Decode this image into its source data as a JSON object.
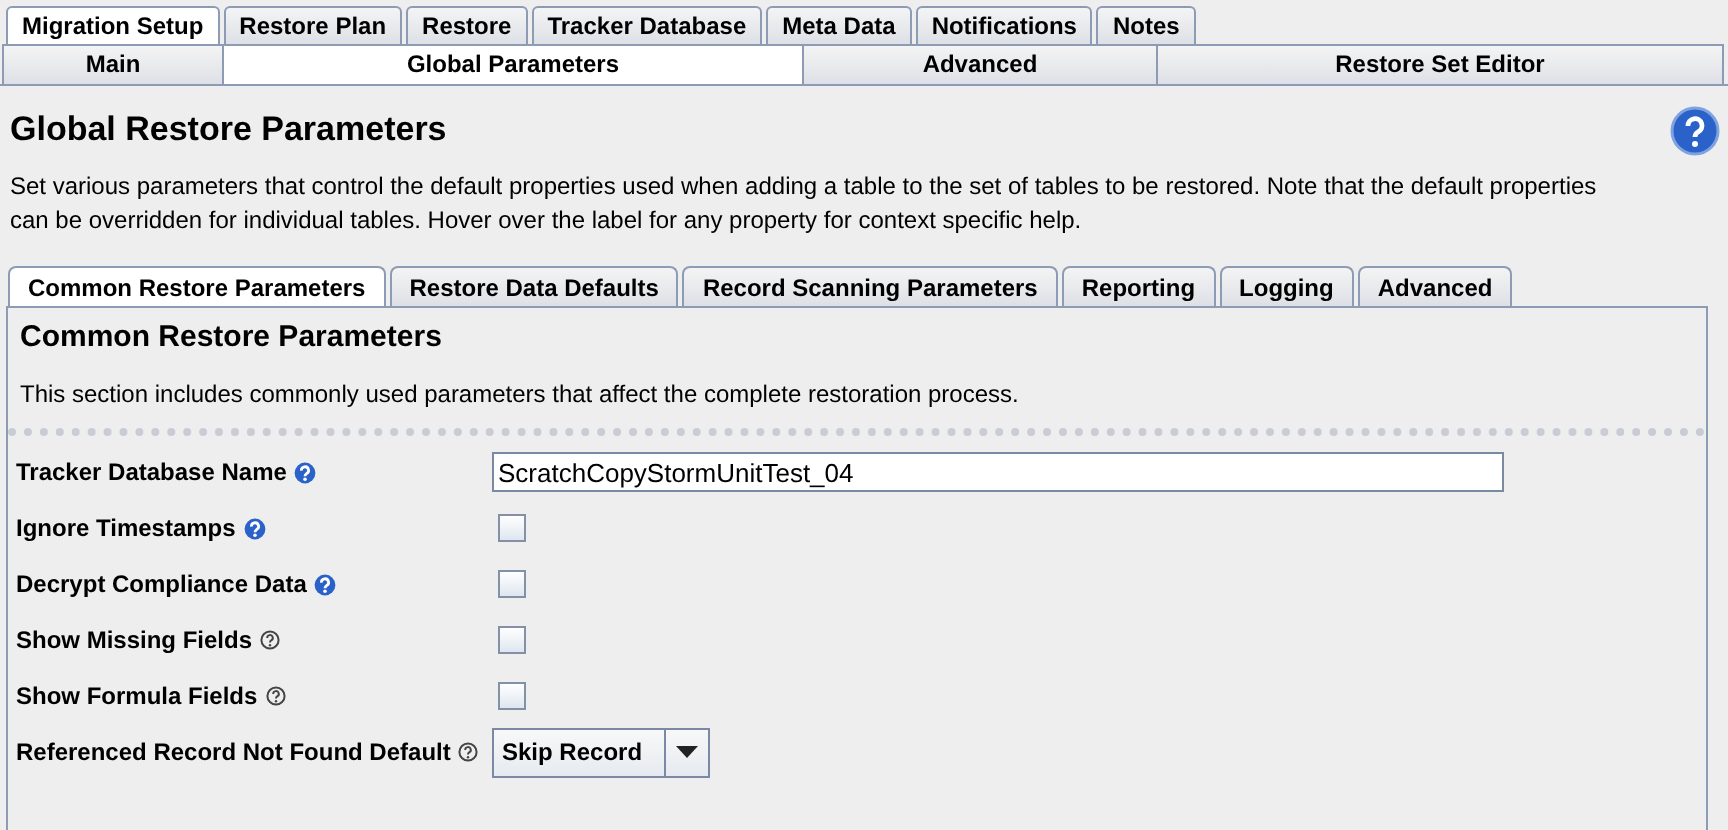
{
  "top_tabs": [
    {
      "label": "Migration Setup",
      "selected": true
    },
    {
      "label": "Restore Plan",
      "selected": false
    },
    {
      "label": "Restore",
      "selected": false
    },
    {
      "label": "Tracker Database",
      "selected": false
    },
    {
      "label": "Meta Data",
      "selected": false
    },
    {
      "label": "Notifications",
      "selected": false
    },
    {
      "label": "Notes",
      "selected": false
    }
  ],
  "sub_tabs": [
    {
      "label": "Main",
      "selected": false
    },
    {
      "label": "Global Parameters",
      "selected": true
    },
    {
      "label": "Advanced",
      "selected": false
    },
    {
      "label": "Restore Set Editor",
      "selected": false
    }
  ],
  "title": "Global Restore Parameters",
  "description": "Set various parameters that control the default properties used when adding a table to the set of tables to be restored. Note that the default properties can be overridden for individual tables. Hover over the label for any property for context specific help.",
  "section_tabs": [
    {
      "label": "Common Restore Parameters",
      "selected": true
    },
    {
      "label": "Restore Data Defaults",
      "selected": false
    },
    {
      "label": "Record Scanning Parameters",
      "selected": false
    },
    {
      "label": "Reporting",
      "selected": false
    },
    {
      "label": "Logging",
      "selected": false
    },
    {
      "label": "Advanced",
      "selected": false
    }
  ],
  "section": {
    "title": "Common Restore Parameters",
    "description": "This section includes commonly used parameters that affect the complete restoration process."
  },
  "properties": [
    {
      "label": "Tracker Database Name",
      "help_highlighted": true,
      "kind": "text",
      "value": "ScratchCopyStormUnitTest_04"
    },
    {
      "label": "Ignore Timestamps",
      "help_highlighted": true,
      "kind": "checkbox",
      "checked": false
    },
    {
      "label": "Decrypt Compliance Data",
      "help_highlighted": true,
      "kind": "checkbox",
      "checked": false
    },
    {
      "label": "Show Missing Fields",
      "help_highlighted": false,
      "kind": "checkbox",
      "checked": false
    },
    {
      "label": "Show Formula Fields",
      "help_highlighted": false,
      "kind": "checkbox",
      "checked": false
    },
    {
      "label": "Referenced Record Not Found Default",
      "help_highlighted": false,
      "kind": "select",
      "value": "Skip Record"
    }
  ]
}
